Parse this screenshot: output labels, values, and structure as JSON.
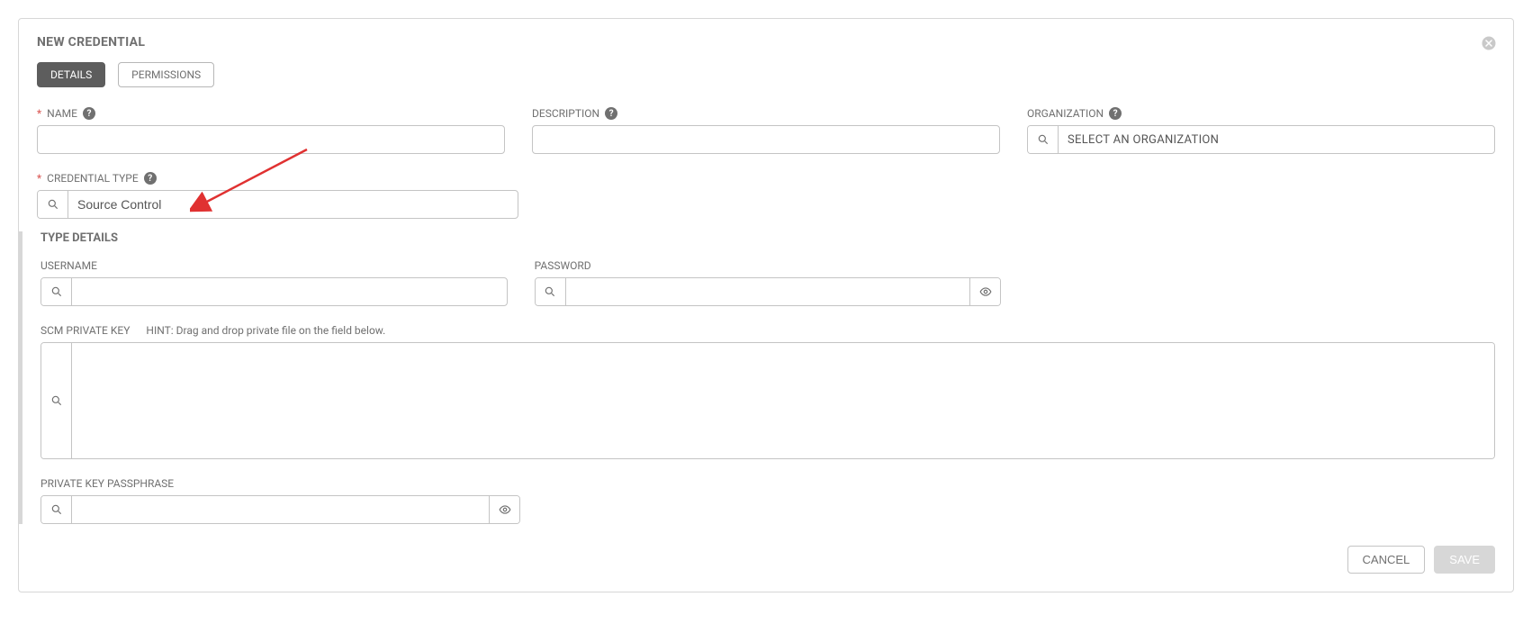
{
  "header": {
    "title": "NEW CREDENTIAL"
  },
  "tabs": {
    "details": "DETAILS",
    "permissions": "PERMISSIONS"
  },
  "fields": {
    "name": {
      "label": "NAME",
      "value": ""
    },
    "description": {
      "label": "DESCRIPTION",
      "value": ""
    },
    "organization": {
      "label": "ORGANIZATION",
      "placeholder": "SELECT AN ORGANIZATION",
      "value": ""
    },
    "credential_type": {
      "label": "CREDENTIAL TYPE",
      "value": "Source Control"
    }
  },
  "type_details": {
    "title": "TYPE DETAILS",
    "username": {
      "label": "USERNAME",
      "value": ""
    },
    "password": {
      "label": "PASSWORD",
      "value": ""
    },
    "scm_private_key": {
      "label": "SCM PRIVATE KEY",
      "hint": "HINT: Drag and drop private file on the field below.",
      "value": ""
    },
    "passphrase": {
      "label": "PRIVATE KEY PASSPHRASE",
      "value": ""
    }
  },
  "footer": {
    "cancel": "CANCEL",
    "save": "SAVE"
  }
}
